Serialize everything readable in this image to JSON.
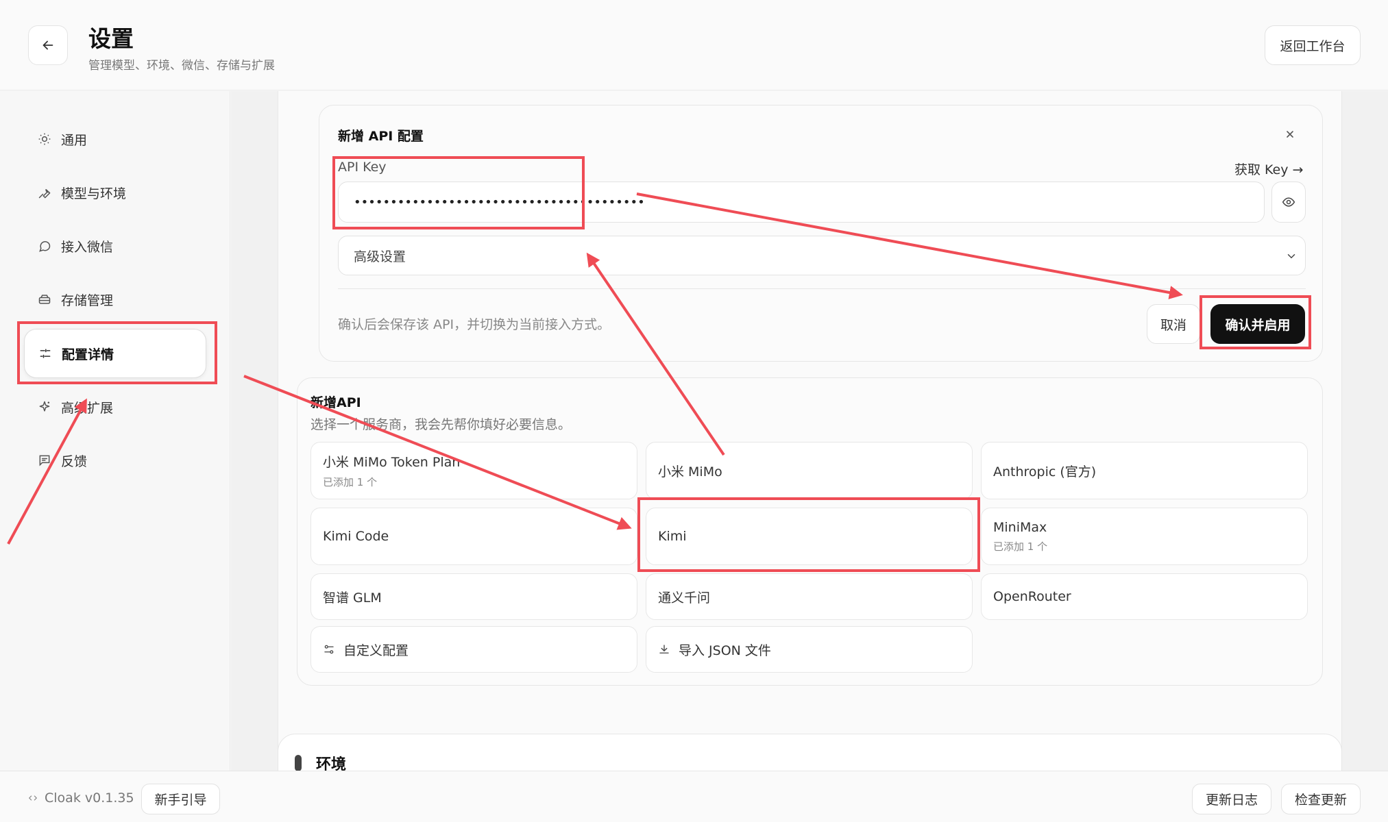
{
  "header": {
    "title": "设置",
    "subtitle": "管理模型、环境、微信、存储与扩展",
    "back_workspace_label": "返回工作台"
  },
  "sidebar": {
    "items": [
      {
        "label": "通用",
        "icon": "sun-icon"
      },
      {
        "label": "模型与环境",
        "icon": "wrench-icon"
      },
      {
        "label": "接入微信",
        "icon": "chat-bubble-icon"
      },
      {
        "label": "存储管理",
        "icon": "storage-icon"
      },
      {
        "label": "配置详情",
        "icon": "sliders-icon",
        "active": true
      },
      {
        "label": "高级扩展",
        "icon": "sparkle-icon"
      },
      {
        "label": "反馈",
        "icon": "feedback-icon"
      }
    ]
  },
  "api_form": {
    "title": "新增 API 配置",
    "api_key_label": "API Key",
    "get_key_link": "获取 Key →",
    "api_key_value": "••••••••••••••••••••••••••••••••••••••••",
    "advanced_label": "高级设置",
    "note": "确认后会保存该 API，并切换为当前接入方式。",
    "cancel_label": "取消",
    "confirm_label": "确认并启用"
  },
  "providers": {
    "title": "新增API",
    "subtitle": "选择一个服务商，我会先帮你填好必要信息。",
    "items": [
      {
        "name": "小米 MiMo Token Plan",
        "sub": "已添加 1 个"
      },
      {
        "name": "小米 MiMo",
        "sub": ""
      },
      {
        "name": "Anthropic (官方)",
        "sub": ""
      },
      {
        "name": "Kimi Code",
        "sub": ""
      },
      {
        "name": "Kimi",
        "sub": ""
      },
      {
        "name": "MiniMax",
        "sub": "已添加 1 个"
      },
      {
        "name": "智谱 GLM",
        "sub": ""
      },
      {
        "name": "通义千问",
        "sub": ""
      },
      {
        "name": "OpenRouter",
        "sub": ""
      }
    ],
    "custom_label": "自定义配置",
    "import_label": "导入 JSON 文件"
  },
  "env": {
    "title": "环境"
  },
  "footer": {
    "version": "Cloak v0.1.35",
    "guide_label": "新手引导",
    "changelog_label": "更新日志",
    "check_update_label": "检查更新"
  },
  "colors": {
    "highlight": "#ef4c55",
    "confirm_bg": "#111111"
  }
}
